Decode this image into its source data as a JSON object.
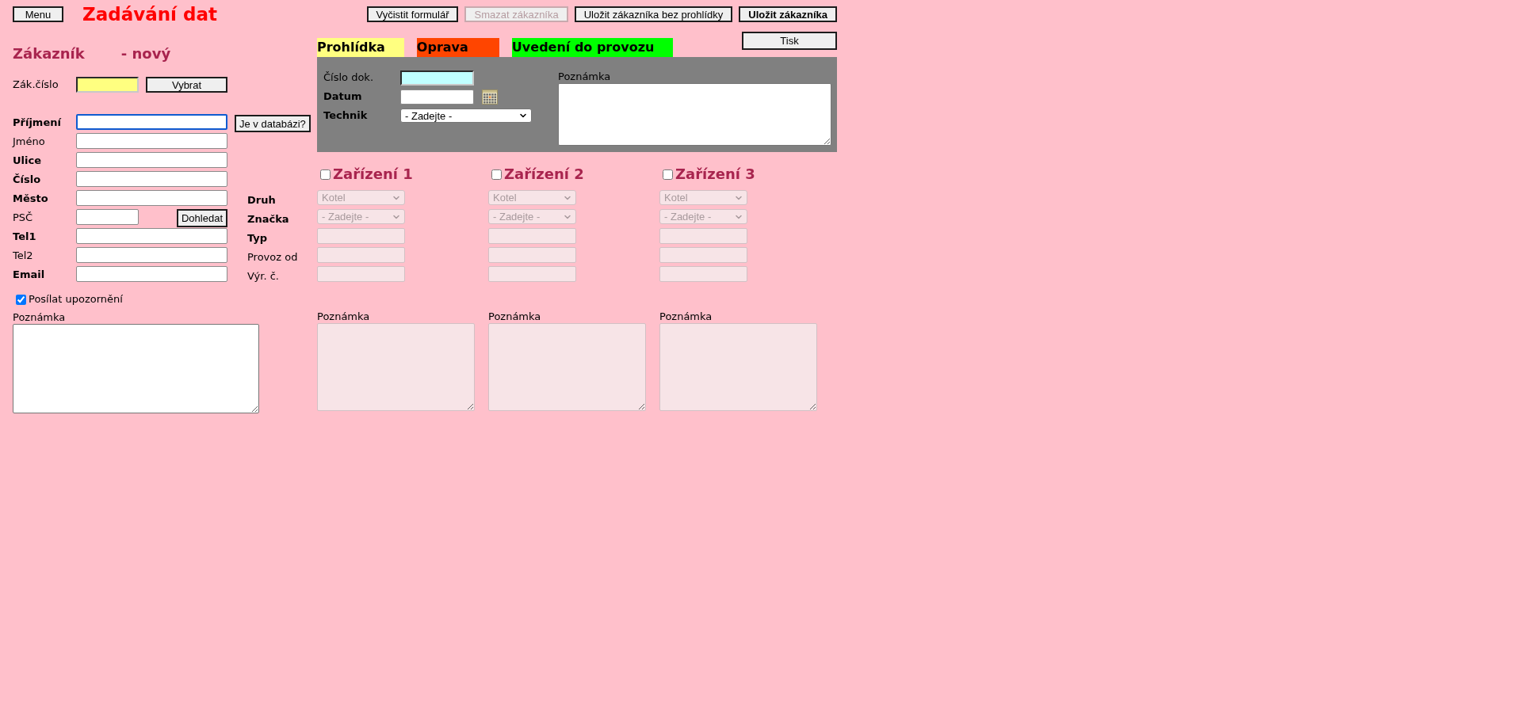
{
  "header": {
    "menu_button": "Menu",
    "title": "Zadávání dat",
    "actions": [
      {
        "label": "Vyčistit formulář",
        "disabled": false,
        "primary": false
      },
      {
        "label": "Smazat zákazníka",
        "disabled": true,
        "primary": false
      },
      {
        "label": "Uložit zákazníka bez prohlídky",
        "disabled": false,
        "primary": false
      },
      {
        "label": "Uložit zákazníka",
        "disabled": false,
        "primary": true
      }
    ],
    "print_button": "Tisk"
  },
  "customer": {
    "heading": "Zákazník",
    "status": "- nový",
    "number": {
      "label": "Zák.číslo",
      "button": "Vybrat"
    },
    "fields": [
      {
        "label": "Příjmení",
        "kind": "text",
        "required": true,
        "focused": true,
        "button": "Je v databázi?"
      },
      {
        "label": "Jméno",
        "kind": "text",
        "required": false,
        "focused": false
      },
      {
        "label": "Ulice",
        "kind": "text",
        "required": true,
        "focused": false
      },
      {
        "label": "Číslo",
        "kind": "text",
        "required": true,
        "focused": false
      },
      {
        "label": "Město",
        "kind": "text",
        "required": true,
        "focused": false
      },
      {
        "label": "PSČ",
        "kind": "short",
        "required": false,
        "focused": false,
        "button": "Dohledat"
      },
      {
        "label": "Tel1",
        "kind": "text",
        "required": true,
        "focused": false
      },
      {
        "label": "Tel2",
        "kind": "text",
        "required": false,
        "focused": false
      },
      {
        "label": "Email",
        "kind": "text",
        "required": true,
        "focused": false
      }
    ],
    "notify": {
      "label": "Posílat upozornění",
      "checked": true
    },
    "note_label": "Poznámka"
  },
  "tabs": [
    {
      "label": "Prohlídka",
      "color": "#ffff80"
    },
    {
      "label": "Oprava",
      "color": "#ff4500"
    },
    {
      "label": "Uvedení do provozu",
      "color": "#00ff00"
    }
  ],
  "visit": {
    "fields": [
      {
        "label": "Číslo dok.",
        "kind": "key",
        "required": false,
        "color": "#c0ffff"
      },
      {
        "label": "Datum",
        "kind": "date",
        "required": true,
        "color": "#ffffff"
      },
      {
        "label": "Technik",
        "kind": "select",
        "required": true,
        "value": "- Zadejte -",
        "color": "#ffffff"
      }
    ],
    "note_label": "Poznámka"
  },
  "device_fields": [
    {
      "label": "Druh",
      "required": true
    },
    {
      "label": "Značka",
      "required": true
    },
    {
      "label": "Typ",
      "required": true
    },
    {
      "label": "Provoz od",
      "required": false
    },
    {
      "label": "Výr. č.",
      "required": false
    }
  ],
  "devices": [
    {
      "title": "Zařízení 1",
      "checked": false,
      "disabled": true,
      "fields": [
        {
          "kind": "select",
          "value": "Kotel"
        },
        {
          "kind": "select",
          "value": "- Zadejte -"
        },
        {
          "kind": "text"
        },
        {
          "kind": "text"
        },
        {
          "kind": "text"
        }
      ],
      "note_label": "Poznámka"
    },
    {
      "title": "Zařízení 2",
      "checked": false,
      "disabled": true,
      "fields": [
        {
          "kind": "select",
          "value": "Kotel"
        },
        {
          "kind": "select",
          "value": "- Zadejte -"
        },
        {
          "kind": "text"
        },
        {
          "kind": "text"
        },
        {
          "kind": "text"
        }
      ],
      "note_label": "Poznámka"
    },
    {
      "title": "Zařízení 3",
      "checked": false,
      "disabled": true,
      "fields": [
        {
          "kind": "select",
          "value": "Kotel"
        },
        {
          "kind": "select",
          "value": "- Zadejte -"
        },
        {
          "kind": "text"
        },
        {
          "kind": "text"
        },
        {
          "kind": "text"
        }
      ],
      "note_label": "Poznámka"
    }
  ]
}
